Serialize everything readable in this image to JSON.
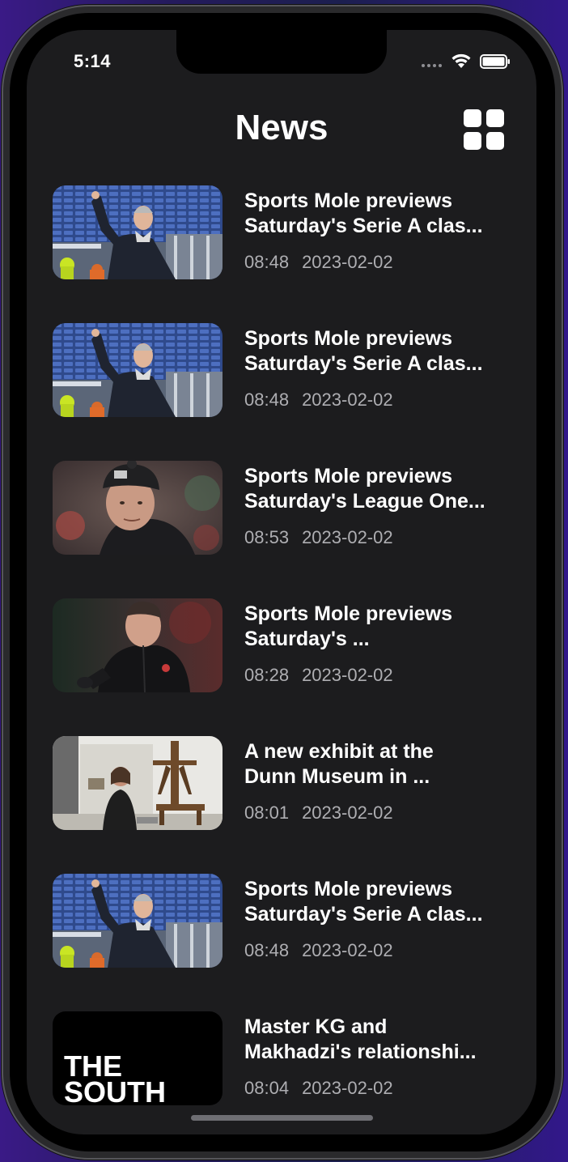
{
  "status_bar": {
    "time": "5:14"
  },
  "header": {
    "title": "News"
  },
  "news": [
    {
      "title": "Sports Mole previews\nSaturday's Serie A clas...",
      "time": "08:48",
      "date": "2023-02-02",
      "thumb": "coach-stadium"
    },
    {
      "title": "Sports Mole previews\nSaturday's Serie A clas...",
      "time": "08:48",
      "date": "2023-02-02",
      "thumb": "coach-stadium"
    },
    {
      "title": "Sports Mole previews\nSaturday's League One...",
      "time": "08:53",
      "date": "2023-02-02",
      "thumb": "coach-beanie"
    },
    {
      "title": "Sports Mole previews\nSaturday's ...",
      "time": "08:28",
      "date": "2023-02-02",
      "thumb": "coach-jacket"
    },
    {
      "title": "A new exhibit at the\nDunn Museum in ...",
      "time": "08:01",
      "date": "2023-02-02",
      "thumb": "museum-exhibit"
    },
    {
      "title": "Sports Mole previews\nSaturday's Serie A clas...",
      "time": "08:48",
      "date": "2023-02-02",
      "thumb": "coach-stadium"
    },
    {
      "title": "Master KG and\nMakhadzi's relationshi...",
      "time": "08:04",
      "date": "2023-02-02",
      "thumb": "the-south-logo",
      "logo_text": "THE\nSOUTH"
    }
  ]
}
